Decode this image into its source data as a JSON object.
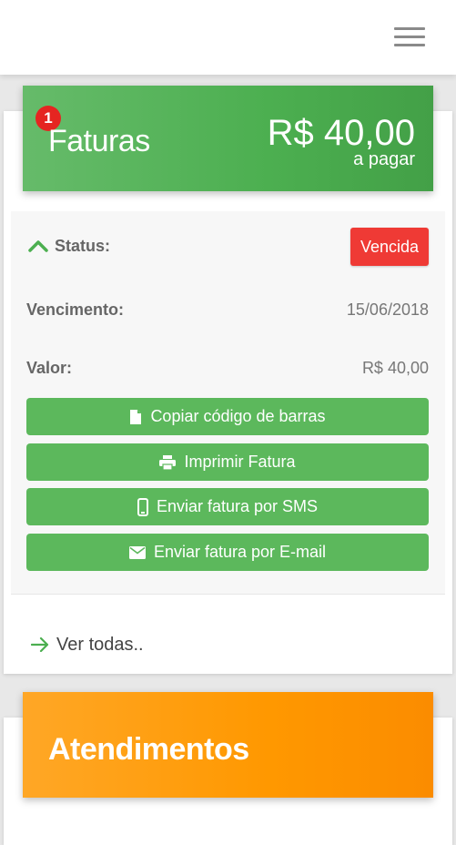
{
  "header": {
    "menu_icon": "hamburger-menu-icon"
  },
  "faturas": {
    "badge_count": "1",
    "title": "Faturas",
    "amount": "R$ 40,00",
    "amount_label": "a pagar",
    "accent": "#4caf50",
    "status_label": "Status:",
    "status_value": "Vencida",
    "status_color": "#ef3a35",
    "vencimento_label": "Vencimento:",
    "vencimento_value": "15/06/2018",
    "valor_label": "Valor:",
    "valor_value": "R$ 40,00",
    "actions": [
      {
        "label": "Copiar código de barras",
        "icon": "file-icon"
      },
      {
        "label": "Imprimir Fatura",
        "icon": "printer-icon"
      },
      {
        "label": "Enviar fatura por SMS",
        "icon": "mobile-phone-icon"
      },
      {
        "label": "Enviar fatura por E-mail",
        "icon": "envelope-icon"
      }
    ],
    "see_all": "Ver todas.."
  },
  "atendimentos": {
    "title": "Atendimentos",
    "accent": "#ff9800"
  }
}
